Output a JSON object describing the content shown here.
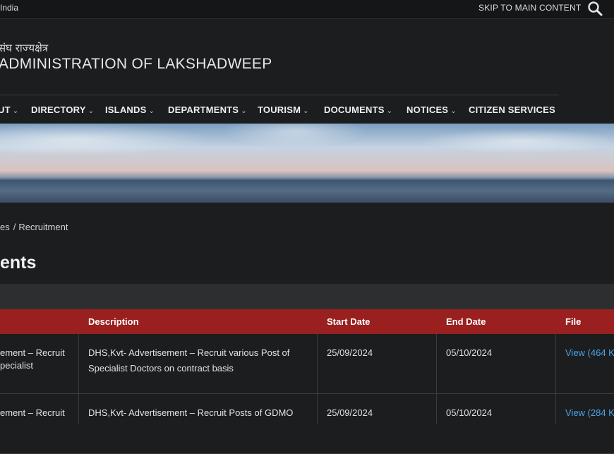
{
  "topbar": {
    "gov_label": "India",
    "skip_label": "SKIP TO MAIN CONTENT"
  },
  "brand": {
    "hindi": "संघ राज्यक्षेत्र",
    "title": "ADMINISTRATION OF LAKSHADWEEP"
  },
  "nav": {
    "items": [
      {
        "label": "UT"
      },
      {
        "label": "DIRECTORY"
      },
      {
        "label": "ISLANDS"
      },
      {
        "label": "DEPARTMENTS"
      },
      {
        "label": "TOURISM"
      },
      {
        "label": "DOCUMENTS"
      },
      {
        "label": "NOTICES"
      },
      {
        "label": "CITIZEN SERVICES"
      }
    ]
  },
  "breadcrumb": {
    "parent": "es",
    "separator": "/",
    "current": "Recruitment"
  },
  "page": {
    "title": "ents"
  },
  "table": {
    "headers": [
      "Description",
      "Start Date",
      "End Date",
      "File"
    ],
    "rows": [
      {
        "title_line1": "ement – Recruit",
        "title_line2": "pecialist",
        "description_line1": "DHS,Kvt- Advertisement – Recruit  various Post of",
        "description_line2": "Specialist Doctors on contract basis",
        "start": "25/09/2024",
        "end": "05/10/2024",
        "file": "View (464 K"
      },
      {
        "title_line1": "ement – Recruit",
        "title_line2": "",
        "description_line1": "DHS,Kvt- Advertisement – Recruit  Posts of GDMO",
        "description_line2": "",
        "start": "25/09/2024",
        "end": "05/10/2024",
        "file": "View (284 K"
      }
    ]
  },
  "colors": {
    "background": "#1c1d1f",
    "table_header": "#9a1f1f",
    "link": "#4da3e6"
  }
}
